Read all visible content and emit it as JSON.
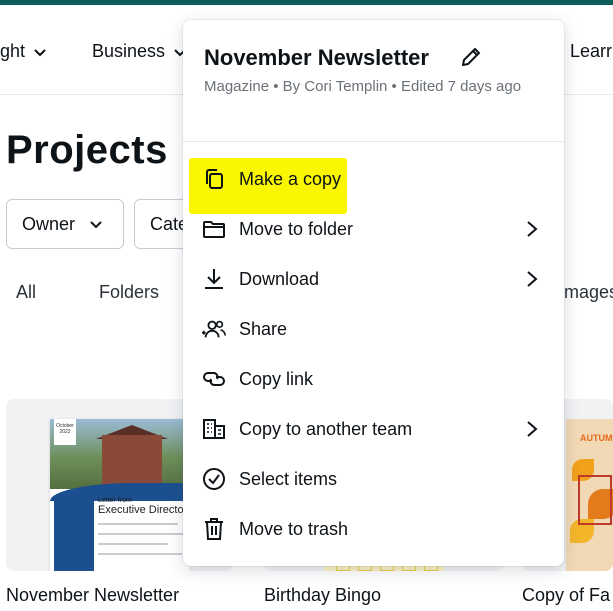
{
  "nav": {
    "item_1": "ight",
    "item_2": "Business",
    "item_3": "Learr"
  },
  "page": {
    "title": "Projects"
  },
  "filters": {
    "owner": "Owner",
    "category": "Cate"
  },
  "tabs": {
    "all": "All",
    "folders": "Folders",
    "images": "mages"
  },
  "cards": [
    {
      "label": "November Newsletter",
      "thumb_tag": "October 2022",
      "thumb_heading_small": "Letter from",
      "thumb_heading": "Executive Director"
    },
    {
      "label": "Birthday Bingo"
    },
    {
      "label": "Copy of Fa",
      "thumb_title": "AUTUM"
    }
  ],
  "menu": {
    "title": "November Newsletter",
    "meta": "Magazine • By Cori Templin • Edited 7 days ago",
    "items": [
      {
        "label": "Make a copy",
        "icon": "copy-icon",
        "submenu": false,
        "highlighted": true
      },
      {
        "label": "Move to folder",
        "icon": "folder-icon",
        "submenu": true
      },
      {
        "label": "Download",
        "icon": "download-icon",
        "submenu": true
      },
      {
        "label": "Share",
        "icon": "share-people-icon",
        "submenu": false
      },
      {
        "label": "Copy link",
        "icon": "link-icon",
        "submenu": false
      },
      {
        "label": "Copy to another team",
        "icon": "building-icon",
        "submenu": true
      },
      {
        "label": "Select items",
        "icon": "check-circle-icon",
        "submenu": false
      },
      {
        "label": "Move to trash",
        "icon": "trash-icon",
        "submenu": false
      }
    ]
  },
  "colors": {
    "topbar": "#0d5d5b",
    "highlight": "#fbf700",
    "text": "#0e1318",
    "meta": "#6b7178"
  }
}
